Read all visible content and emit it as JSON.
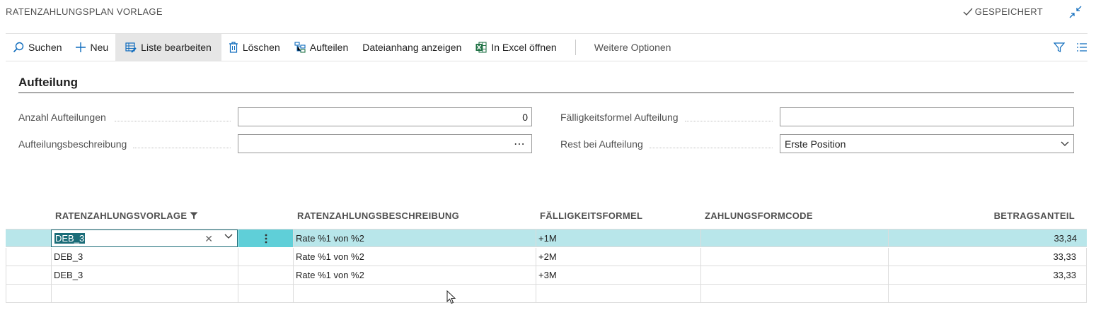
{
  "header": {
    "title": "RATENZAHLUNGSPLAN VORLAGE",
    "saved": "GESPEICHERT"
  },
  "toolbar": {
    "search": "Suchen",
    "new": "Neu",
    "edit_list": "Liste bearbeiten",
    "delete": "Löschen",
    "split": "Aufteilen",
    "attachment": "Dateianhang anzeigen",
    "excel": "In Excel öffnen",
    "more": "Weitere Optionen"
  },
  "section": {
    "title": "Aufteilung",
    "fields": {
      "count_label": "Anzahl Aufteilungen",
      "count_value": "0",
      "desc_label": "Aufteilungsbeschreibung",
      "desc_value": "",
      "due_label": "Fälligkeitsformel Aufteilung",
      "due_value": "",
      "rest_label": "Rest bei Aufteilung",
      "rest_value": "Erste Position"
    }
  },
  "grid": {
    "columns": [
      "RATENZAHLUNGSVORLAGE",
      "RATENZAHLUNGSBESCHREIBUNG",
      "FÄLLIGKEITSFORMEL",
      "ZAHLUNGSFORMCODE",
      "BETRAGSANTEIL"
    ],
    "rows": [
      {
        "template": "DEB_3",
        "description": "Rate %1 von %2",
        "formula": "+1M",
        "payment_code": "",
        "share": "33,34"
      },
      {
        "template": "DEB_3",
        "description": "Rate %1 von %2",
        "formula": "+2M",
        "payment_code": "",
        "share": "33,33"
      },
      {
        "template": "DEB_3",
        "description": "Rate %1 von %2",
        "formula": "+3M",
        "payment_code": "",
        "share": "33,33"
      },
      {
        "template": "",
        "description": "",
        "formula": "",
        "payment_code": "",
        "share": ""
      }
    ]
  },
  "colors": {
    "accent": "#1a6c78",
    "selected_row": "#b8e6ea",
    "dots_button": "#5fcfd8",
    "icon_blue": "#0f6cbd",
    "excel_green": "#217346"
  }
}
